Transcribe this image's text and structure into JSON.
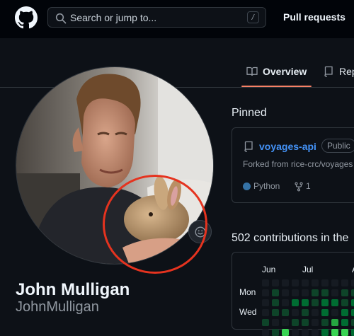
{
  "header": {
    "search_placeholder": "Search or jump to...",
    "search_shortcut": "/",
    "nav_pull_requests": "Pull requests"
  },
  "tabs": [
    {
      "label": "Overview",
      "icon": "book-icon",
      "active": true
    },
    {
      "label": "Rep",
      "icon": "repo-icon",
      "active": false
    }
  ],
  "profile": {
    "name": "John Mulligan",
    "login": "JohnMulligan"
  },
  "pinned": {
    "title": "Pinned",
    "repos": [
      {
        "name": "voyages-api",
        "visibility": "Public",
        "fork_note": "Forked from rice-crc/voyages",
        "language": "Python",
        "language_color": "#3572A5",
        "forks": "1"
      }
    ]
  },
  "contributions": {
    "title": "502 contributions in the",
    "months": [
      "Jun",
      "Jul",
      "A"
    ],
    "day_labels": [
      "Mon",
      "Wed"
    ],
    "level_colors": [
      "#161b22",
      "#0e4429",
      "#006d32",
      "#26a641",
      "#39d353"
    ],
    "grid_levels": [
      [
        0,
        0,
        0,
        0,
        0,
        0,
        0,
        0,
        0,
        0,
        0
      ],
      [
        0,
        1,
        0,
        0,
        0,
        1,
        1,
        0,
        1,
        1,
        0
      ],
      [
        0,
        1,
        0,
        2,
        2,
        1,
        2,
        2,
        1,
        2,
        1
      ],
      [
        0,
        1,
        1,
        0,
        1,
        0,
        2,
        0,
        2,
        2,
        1
      ],
      [
        1,
        0,
        0,
        1,
        1,
        0,
        1,
        3,
        2,
        1,
        0
      ],
      [
        0,
        1,
        4,
        0,
        0,
        0,
        2,
        4,
        4,
        2,
        1
      ]
    ]
  },
  "colors": {
    "background": "#0d1117",
    "header_background": "#010409",
    "link": "#4493f8",
    "tab_underline": "#f78166",
    "annotation": "#e5331f"
  }
}
